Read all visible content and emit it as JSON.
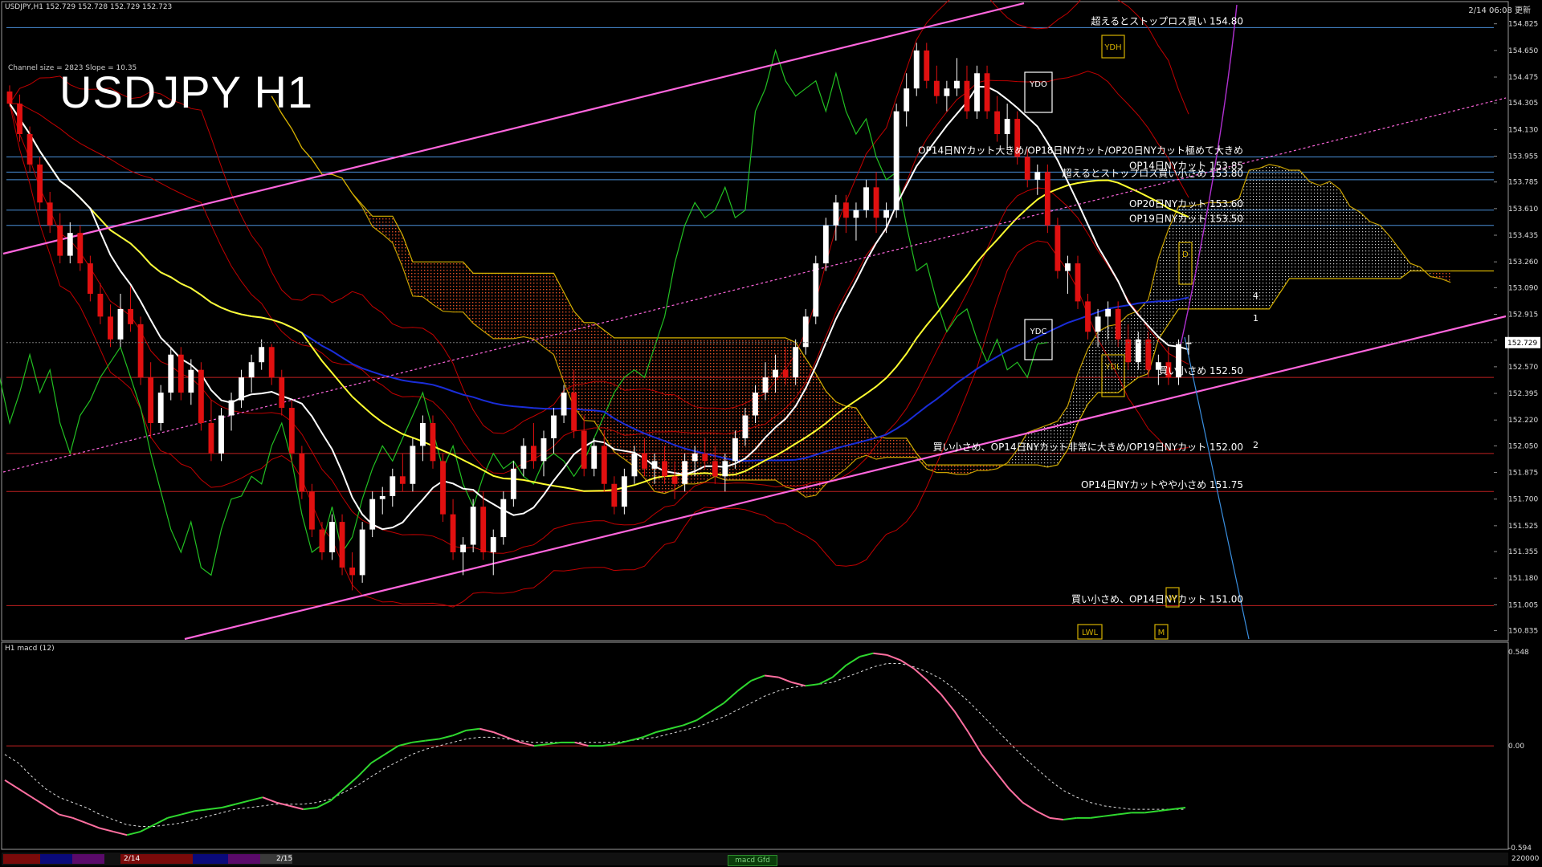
{
  "header": {
    "symbol_info": "USDJPY,H1  152.729 152.728 152.729 152.723",
    "big_title": "USDJPY H1",
    "channel_info": "Channel size = 2823 Slope = 10.35",
    "datetime": "2/14 06:08 更新",
    "subpanel_title": "H1  macd (12)"
  },
  "chart_data": {
    "type": "line",
    "symbol": "USDJPY",
    "timeframe": "H1",
    "price_axis_ticks": [
      "154.825",
      "154.650",
      "154.475",
      "154.305",
      "154.130",
      "153.955",
      "153.785",
      "153.610",
      "153.435",
      "153.260",
      "153.090",
      "152.915",
      "152.745",
      "152.570",
      "152.395",
      "152.220",
      "152.050",
      "151.875",
      "151.700",
      "151.525",
      "151.355",
      "151.180",
      "151.005",
      "150.835"
    ],
    "current_price": "152.729",
    "ylim": [
      150.78,
      154.95
    ],
    "levels": [
      {
        "price": 154.8,
        "label": "超えるとストップロス買い 154.80",
        "color": "#4a8fd8"
      },
      {
        "price": 153.95,
        "label": "OP14日NYカット大きめ/OP18日NYカット/OP20日NYカット極めて大きめ",
        "color": "#4a8fd8"
      },
      {
        "price": 153.85,
        "label": "OP14日NYカット 153.85",
        "color": "#4a8fd8"
      },
      {
        "price": 153.8,
        "label": "超えるとストップロス買い小さめ 153.80",
        "color": "#4a8fd8"
      },
      {
        "price": 153.6,
        "label": "OP20日NYカット 153.60",
        "color": "#4a8fd8"
      },
      {
        "price": 153.5,
        "label": "OP19日NYカット 153.50",
        "color": "#4a8fd8"
      },
      {
        "price": 152.5,
        "label": "買い小さめ 152.50",
        "color": "#c02020"
      },
      {
        "price": 152.0,
        "label": "買い小さめ、OP14日NYカット非常に大きめ/OP19日NYカット 152.00",
        "color": "#c02020"
      },
      {
        "price": 151.75,
        "label": "OP14日NYカットやや小さめ 151.75",
        "color": "#c02020"
      },
      {
        "price": 151.0,
        "label": "買い小さめ、OP14日NYカット 151.00",
        "color": "#c02020"
      }
    ],
    "box_labels": [
      "YDH",
      "YDO",
      "YDC",
      "YDL",
      "LWL",
      "D",
      "W",
      "M"
    ],
    "wave_labels": [
      "4",
      "1",
      "2"
    ],
    "candles": [
      [
        154.38,
        154.42,
        154.28,
        154.3
      ],
      [
        154.3,
        154.36,
        154.05,
        154.1
      ],
      [
        154.1,
        154.15,
        153.85,
        153.9
      ],
      [
        153.9,
        153.95,
        153.6,
        153.65
      ],
      [
        153.65,
        153.72,
        153.45,
        153.5
      ],
      [
        153.5,
        153.58,
        153.25,
        153.3
      ],
      [
        153.3,
        153.52,
        153.25,
        153.45
      ],
      [
        153.45,
        153.5,
        153.2,
        153.25
      ],
      [
        153.25,
        153.3,
        153.0,
        153.05
      ],
      [
        153.05,
        153.12,
        152.85,
        152.9
      ],
      [
        152.9,
        152.98,
        152.7,
        152.75
      ],
      [
        152.75,
        153.05,
        152.7,
        152.95
      ],
      [
        152.95,
        153.1,
        152.8,
        152.85
      ],
      [
        152.85,
        152.9,
        152.45,
        152.5
      ],
      [
        152.5,
        152.6,
        152.1,
        152.2
      ],
      [
        152.2,
        152.45,
        152.15,
        152.4
      ],
      [
        152.4,
        152.7,
        152.35,
        152.65
      ],
      [
        152.65,
        152.7,
        152.35,
        152.4
      ],
      [
        152.4,
        152.62,
        152.32,
        152.55
      ],
      [
        152.55,
        152.6,
        152.15,
        152.2
      ],
      [
        152.2,
        152.35,
        151.95,
        152.0
      ],
      [
        152.0,
        152.3,
        151.95,
        152.25
      ],
      [
        152.25,
        152.4,
        152.15,
        152.35
      ],
      [
        152.35,
        152.55,
        152.3,
        152.5
      ],
      [
        152.5,
        152.65,
        152.4,
        152.6
      ],
      [
        152.6,
        152.75,
        152.55,
        152.7
      ],
      [
        152.7,
        152.72,
        152.45,
        152.5
      ],
      [
        152.5,
        152.55,
        152.25,
        152.3
      ],
      [
        152.3,
        152.35,
        151.95,
        152.0
      ],
      [
        152.0,
        152.05,
        151.7,
        151.75
      ],
      [
        151.75,
        151.8,
        151.45,
        151.5
      ],
      [
        151.5,
        151.55,
        151.3,
        151.35
      ],
      [
        151.35,
        151.6,
        151.3,
        151.55
      ],
      [
        151.55,
        151.6,
        151.2,
        151.25
      ],
      [
        151.25,
        151.35,
        151.1,
        151.2
      ],
      [
        151.2,
        151.55,
        151.15,
        151.5
      ],
      [
        151.5,
        151.75,
        151.45,
        151.7
      ],
      [
        151.7,
        151.78,
        151.6,
        151.72
      ],
      [
        151.72,
        151.9,
        151.65,
        151.85
      ],
      [
        151.85,
        152.0,
        151.75,
        151.8
      ],
      [
        151.8,
        152.1,
        151.75,
        152.05
      ],
      [
        152.05,
        152.25,
        151.95,
        152.2
      ],
      [
        152.2,
        152.25,
        151.9,
        151.95
      ],
      [
        151.95,
        152.0,
        151.55,
        151.6
      ],
      [
        151.6,
        151.7,
        151.3,
        151.35
      ],
      [
        151.35,
        151.45,
        151.2,
        151.4
      ],
      [
        151.4,
        151.7,
        151.35,
        151.65
      ],
      [
        151.65,
        151.75,
        151.3,
        151.35
      ],
      [
        151.35,
        151.5,
        151.2,
        151.45
      ],
      [
        151.45,
        151.75,
        151.4,
        151.7
      ],
      [
        151.7,
        151.95,
        151.65,
        151.9
      ],
      [
        151.9,
        152.1,
        151.85,
        152.05
      ],
      [
        152.05,
        152.2,
        151.9,
        151.95
      ],
      [
        151.95,
        152.15,
        151.85,
        152.1
      ],
      [
        152.1,
        152.3,
        152.0,
        152.25
      ],
      [
        152.25,
        152.45,
        152.2,
        152.4
      ],
      [
        152.4,
        152.55,
        152.1,
        152.15
      ],
      [
        152.15,
        152.25,
        151.85,
        151.9
      ],
      [
        151.9,
        152.1,
        151.85,
        152.05
      ],
      [
        152.05,
        152.15,
        151.75,
        151.8
      ],
      [
        151.8,
        151.85,
        151.6,
        151.65
      ],
      [
        151.65,
        151.9,
        151.6,
        151.85
      ],
      [
        151.85,
        152.05,
        151.8,
        152.0
      ],
      [
        152.0,
        152.1,
        151.85,
        151.9
      ],
      [
        151.9,
        152.0,
        151.8,
        151.95
      ],
      [
        151.95,
        152.05,
        151.8,
        151.85
      ],
      [
        151.85,
        151.95,
        151.7,
        151.8
      ],
      [
        151.8,
        152.0,
        151.75,
        151.95
      ],
      [
        151.95,
        152.05,
        151.85,
        152.0
      ],
      [
        152.0,
        152.1,
        151.9,
        151.95
      ],
      [
        151.95,
        152.05,
        151.8,
        151.85
      ],
      [
        151.85,
        152.0,
        151.75,
        151.95
      ],
      [
        151.95,
        152.15,
        151.9,
        152.1
      ],
      [
        152.1,
        152.3,
        152.05,
        152.25
      ],
      [
        152.25,
        152.45,
        152.2,
        152.4
      ],
      [
        152.4,
        152.6,
        152.35,
        152.5
      ],
      [
        152.5,
        152.65,
        152.4,
        152.55
      ],
      [
        152.55,
        152.7,
        152.45,
        152.5
      ],
      [
        152.5,
        152.75,
        152.45,
        152.7
      ],
      [
        152.7,
        152.95,
        152.65,
        152.9
      ],
      [
        152.9,
        153.3,
        152.85,
        153.25
      ],
      [
        153.25,
        153.55,
        153.2,
        153.5
      ],
      [
        153.5,
        153.7,
        153.4,
        153.65
      ],
      [
        153.65,
        153.7,
        153.45,
        153.55
      ],
      [
        153.55,
        153.65,
        153.4,
        153.6
      ],
      [
        153.6,
        153.8,
        153.55,
        153.75
      ],
      [
        153.75,
        153.85,
        153.45,
        153.55
      ],
      [
        153.55,
        153.65,
        153.45,
        153.6
      ],
      [
        153.6,
        154.3,
        153.55,
        154.25
      ],
      [
        154.25,
        154.5,
        154.15,
        154.4
      ],
      [
        154.4,
        154.7,
        154.35,
        154.65
      ],
      [
        154.65,
        154.7,
        154.4,
        154.45
      ],
      [
        154.45,
        154.55,
        154.3,
        154.35
      ],
      [
        154.35,
        154.45,
        154.25,
        154.4
      ],
      [
        154.4,
        154.6,
        154.35,
        154.45
      ],
      [
        154.45,
        154.55,
        154.2,
        154.25
      ],
      [
        154.25,
        154.55,
        154.2,
        154.5
      ],
      [
        154.5,
        154.55,
        154.2,
        154.25
      ],
      [
        154.25,
        154.35,
        154.05,
        154.1
      ],
      [
        154.1,
        154.3,
        154.0,
        154.2
      ],
      [
        154.2,
        154.25,
        153.9,
        153.95
      ],
      [
        153.95,
        154.0,
        153.75,
        153.8
      ],
      [
        153.8,
        153.9,
        153.7,
        153.85
      ],
      [
        153.85,
        153.9,
        153.45,
        153.5
      ],
      [
        153.5,
        153.55,
        153.15,
        153.2
      ],
      [
        153.2,
        153.3,
        153.05,
        153.25
      ],
      [
        153.25,
        153.3,
        152.95,
        153.0
      ],
      [
        153.0,
        153.05,
        152.75,
        152.8
      ],
      [
        152.8,
        152.95,
        152.7,
        152.9
      ],
      [
        152.9,
        153.0,
        152.75,
        152.95
      ],
      [
        152.95,
        153.0,
        152.7,
        152.75
      ],
      [
        152.75,
        152.85,
        152.55,
        152.6
      ],
      [
        152.6,
        152.8,
        152.55,
        152.75
      ],
      [
        152.75,
        152.8,
        152.5,
        152.55
      ],
      [
        152.55,
        152.65,
        152.45,
        152.6
      ],
      [
        152.6,
        152.7,
        152.45,
        152.5
      ],
      [
        152.5,
        152.75,
        152.45,
        152.72
      ],
      [
        152.72,
        152.78,
        152.65,
        152.73
      ]
    ],
    "macd": {
      "ylim": [
        -0.594,
        0.548
      ],
      "axis_ticks": [
        "0.548",
        "0.00",
        "-0.594"
      ],
      "main": [
        -0.2,
        -0.25,
        -0.3,
        -0.35,
        -0.4,
        -0.42,
        -0.45,
        -0.48,
        -0.5,
        -0.52,
        -0.5,
        -0.46,
        -0.42,
        -0.4,
        -0.38,
        -0.37,
        -0.36,
        -0.34,
        -0.32,
        -0.3,
        -0.33,
        -0.35,
        -0.37,
        -0.36,
        -0.32,
        -0.25,
        -0.18,
        -0.1,
        -0.05,
        0.0,
        0.02,
        0.03,
        0.04,
        0.06,
        0.09,
        0.1,
        0.08,
        0.05,
        0.02,
        0.0,
        0.01,
        0.02,
        0.02,
        0.0,
        0.0,
        0.01,
        0.03,
        0.05,
        0.08,
        0.1,
        0.12,
        0.15,
        0.2,
        0.25,
        0.32,
        0.38,
        0.41,
        0.4,
        0.37,
        0.35,
        0.36,
        0.4,
        0.47,
        0.52,
        0.54,
        0.53,
        0.5,
        0.45,
        0.38,
        0.3,
        0.2,
        0.08,
        -0.05,
        -0.15,
        -0.25,
        -0.33,
        -0.38,
        -0.42,
        -0.43,
        -0.42,
        -0.42,
        -0.41,
        -0.4,
        -0.39,
        -0.39,
        -0.38,
        -0.37,
        -0.36
      ],
      "signal": [
        -0.05,
        -0.1,
        -0.18,
        -0.25,
        -0.3,
        -0.33,
        -0.36,
        -0.4,
        -0.43,
        -0.46,
        -0.47,
        -0.47,
        -0.46,
        -0.45,
        -0.43,
        -0.41,
        -0.39,
        -0.37,
        -0.36,
        -0.35,
        -0.34,
        -0.34,
        -0.34,
        -0.33,
        -0.31,
        -0.27,
        -0.23,
        -0.18,
        -0.13,
        -0.09,
        -0.05,
        -0.02,
        0.0,
        0.02,
        0.04,
        0.05,
        0.05,
        0.04,
        0.03,
        0.02,
        0.02,
        0.02,
        0.02,
        0.02,
        0.02,
        0.02,
        0.03,
        0.04,
        0.05,
        0.07,
        0.09,
        0.11,
        0.14,
        0.17,
        0.21,
        0.25,
        0.29,
        0.32,
        0.34,
        0.35,
        0.36,
        0.37,
        0.4,
        0.43,
        0.46,
        0.48,
        0.48,
        0.46,
        0.43,
        0.39,
        0.33,
        0.26,
        0.18,
        0.1,
        0.02,
        -0.06,
        -0.13,
        -0.2,
        -0.26,
        -0.3,
        -0.33,
        -0.35,
        -0.36,
        -0.37,
        -0.37,
        -0.37,
        -0.37,
        -0.37
      ]
    }
  },
  "footer": {
    "date_labels": [
      "2/14",
      "2/15"
    ],
    "macd_tag": "macd Gfd",
    "volume_label": "220000"
  },
  "colors": {
    "bull": "#ffffff",
    "bear": "#e01010",
    "ma_white": "#ffffff",
    "ma_yellow": "#ffff30",
    "ma_blue": "#1a2dd8",
    "chikou": "#22c022",
    "cloud": "#ff4d1f",
    "envelope": "#c00000",
    "channel": "#ff66dd",
    "macd_bear": "#ff6fa0",
    "macd_bull": "#2fd82f",
    "grid_blue": "#3a7fd0",
    "grid_red": "#c02020"
  }
}
